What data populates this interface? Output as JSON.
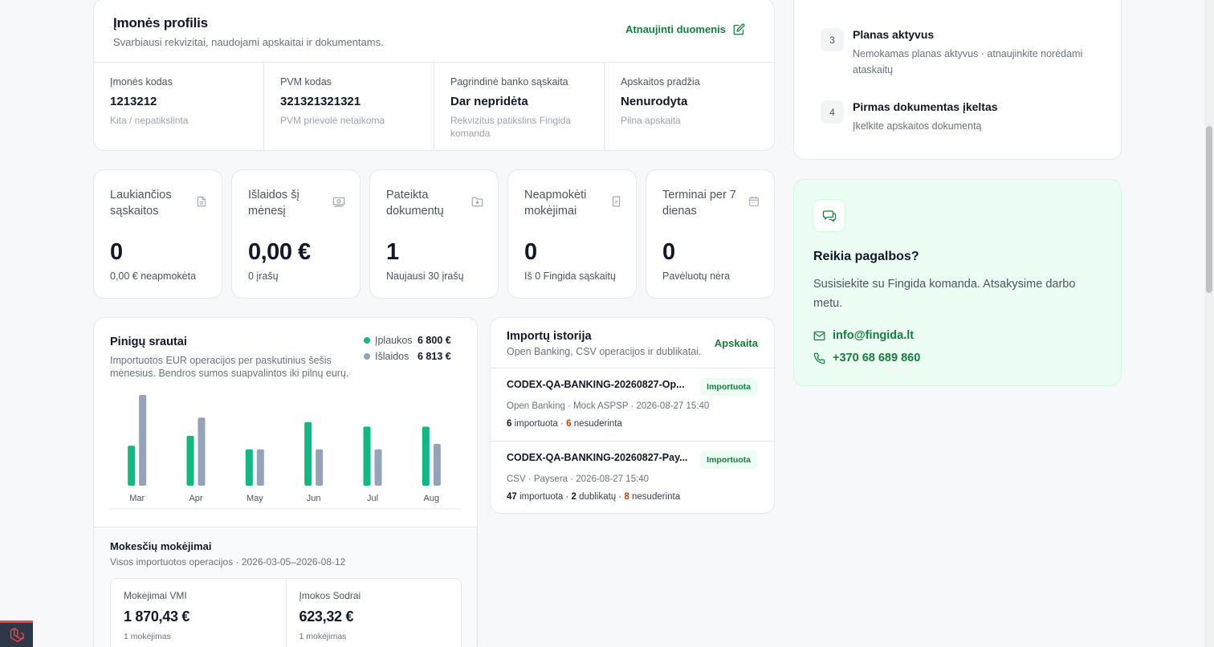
{
  "profile": {
    "title": "Įmonės profilis",
    "subtitle": "Svarbiausi rekvizitai, naudojami apskaitai ir dokumentams.",
    "update_label": "Atnaujinti duomenis",
    "fields": [
      {
        "label": "Įmonės kodas",
        "value": "1213212",
        "note": "Kita / nepatikslinta"
      },
      {
        "label": "PVM kodas",
        "value": "321321321321",
        "note": "PVM prievolė netaikoma"
      },
      {
        "label": "Pagrindinė banko sąskaita",
        "value": "Dar nepridėta",
        "note": "Rekvizitus patikslins Fingida komanda"
      },
      {
        "label": "Apskaitos pradžia",
        "value": "Nenurodyta",
        "note": "Pilna apskaita"
      }
    ]
  },
  "stats": [
    {
      "label": "Laukiančios sąskaitos",
      "value": "0",
      "sub": "0,00 € neapmokėta",
      "icon": "document-icon"
    },
    {
      "label": "Išlaidos šį mėnesį",
      "value": "0,00 €",
      "sub": "0 įrašų",
      "icon": "money-icon"
    },
    {
      "label": "Pateikta dokumentų",
      "value": "1",
      "sub": "Naujausi 30 įrašų",
      "icon": "folder-download-icon"
    },
    {
      "label": "Neapmokėti mokėjimai",
      "value": "0",
      "sub": "Iš 0 Fingida sąskaitų",
      "icon": "receipt-icon"
    },
    {
      "label": "Terminai per 7 dienas",
      "value": "0",
      "sub": "Pavėluotų nėra",
      "icon": "calendar-icon"
    }
  ],
  "cashflow": {
    "title": "Pinigų srautai",
    "subtitle": "Importuotos EUR operacijos per paskutinius šešis mėnesius. Bendros sumos suapvalintos iki pilnų eurų.",
    "legend": [
      {
        "name": "Įplaukos",
        "total": "6 800 €",
        "color": "#10b981"
      },
      {
        "name": "Išlaidos",
        "total": "6 813 €",
        "color": "#94a3b8"
      }
    ]
  },
  "chart_data": {
    "type": "bar",
    "categories": [
      "Mar",
      "Apr",
      "May",
      "Jun",
      "Jul",
      "Aug"
    ],
    "series": [
      {
        "name": "Įplaukos",
        "values": [
          0.44,
          0.55,
          0.4,
          0.7,
          0.65,
          0.65
        ],
        "color": "#10b981"
      },
      {
        "name": "Išlaidos",
        "values": [
          1.0,
          0.75,
          0.4,
          0.4,
          0.4,
          0.46
        ],
        "color": "#94a3b8"
      }
    ],
    "ylim": [
      0,
      1
    ],
    "grid": false
  },
  "taxes": {
    "title": "Mokesčių mokėjimai",
    "subtitle": "Visos importuotos operacijos · 2026-03-05–2026-08-12",
    "items": [
      {
        "label": "Mokėjimai VMI",
        "value": "1 870,43 €",
        "note": "1 mokėjimas"
      },
      {
        "label": "Įmokos Sodrai",
        "value": "623,32 €",
        "note": "1 mokėjimas"
      }
    ]
  },
  "imports": {
    "title": "Importų istorija",
    "subtitle": "Open Banking, CSV operacijos ir dublikatai.",
    "link": "Apskaita",
    "rows": [
      {
        "name": "CODEX-QA-BANKING-20260827-Op...",
        "badge": "Importuota",
        "meta": "Open Banking · Mock ASPSP · 2026-08-27 15:40",
        "imported": "6",
        "imported_label": " importuota · ",
        "duplicates": "",
        "duplicates_label": "",
        "unmatched": "6",
        "unmatched_label": " nesuderinta"
      },
      {
        "name": "CODEX-QA-BANKING-20260827-Pay...",
        "badge": "Importuota",
        "meta": "CSV · Paysera · 2026-08-27 15:40",
        "imported": "47",
        "imported_label": " importuota · ",
        "duplicates": "2",
        "duplicates_label": " dublikatų · ",
        "unmatched": "8",
        "unmatched_label": " nesuderinta"
      }
    ]
  },
  "onboarding": {
    "steps": [
      {
        "num": "3",
        "title": "Planas aktyvus",
        "desc": "Nemokamas planas aktyvus · atnaujinkite norėdami ataskaitų"
      },
      {
        "num": "4",
        "title": "Pirmas dokumentas įkeltas",
        "desc": "Įkelkite apskaitos dokumentą"
      }
    ]
  },
  "help": {
    "title": "Reikia pagalbos?",
    "desc": "Susisiekite su Fingida komanda. Atsakysime darbo metu.",
    "email": "info@fingida.lt",
    "phone": "+370 68 689 860"
  },
  "theme": {
    "accent": "#15803d",
    "income": "#10b981",
    "expense": "#94a3b8",
    "warning": "#c2410c"
  }
}
